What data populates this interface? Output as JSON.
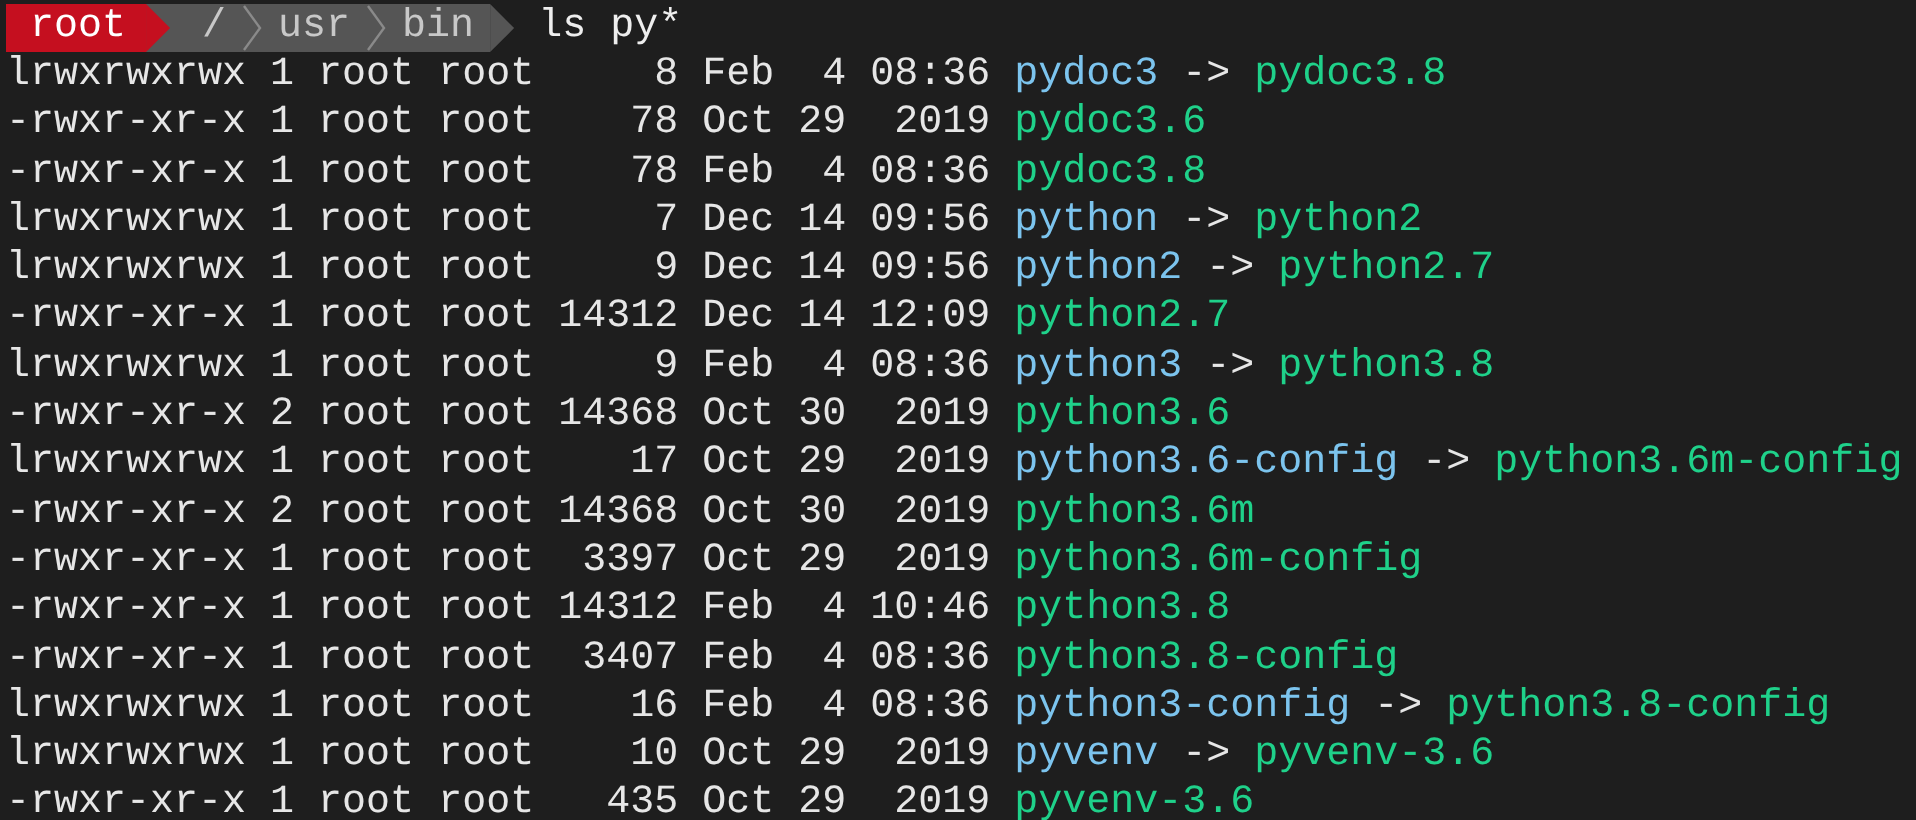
{
  "prompt": {
    "user": "root",
    "path": [
      "/",
      "usr",
      "bin"
    ],
    "command": "ls py*"
  },
  "rows": [
    {
      "mode": "lrwxrwxrwx",
      "links": "1",
      "owner": "root",
      "group": "root",
      "size": "8",
      "date": "Feb  4 08:36",
      "name": "pydoc3",
      "kind": "link",
      "arrow": "->",
      "target": "pydoc3.8"
    },
    {
      "mode": "-rwxr-xr-x",
      "links": "1",
      "owner": "root",
      "group": "root",
      "size": "78",
      "date": "Oct 29  2019",
      "name": "pydoc3.6",
      "kind": "file"
    },
    {
      "mode": "-rwxr-xr-x",
      "links": "1",
      "owner": "root",
      "group": "root",
      "size": "78",
      "date": "Feb  4 08:36",
      "name": "pydoc3.8",
      "kind": "file"
    },
    {
      "mode": "lrwxrwxrwx",
      "links": "1",
      "owner": "root",
      "group": "root",
      "size": "7",
      "date": "Dec 14 09:56",
      "name": "python",
      "kind": "link",
      "arrow": "->",
      "target": "python2"
    },
    {
      "mode": "lrwxrwxrwx",
      "links": "1",
      "owner": "root",
      "group": "root",
      "size": "9",
      "date": "Dec 14 09:56",
      "name": "python2",
      "kind": "link",
      "arrow": "->",
      "target": "python2.7"
    },
    {
      "mode": "-rwxr-xr-x",
      "links": "1",
      "owner": "root",
      "group": "root",
      "size": "14312",
      "date": "Dec 14 12:09",
      "name": "python2.7",
      "kind": "file"
    },
    {
      "mode": "lrwxrwxrwx",
      "links": "1",
      "owner": "root",
      "group": "root",
      "size": "9",
      "date": "Feb  4 08:36",
      "name": "python3",
      "kind": "link",
      "arrow": "->",
      "target": "python3.8"
    },
    {
      "mode": "-rwxr-xr-x",
      "links": "2",
      "owner": "root",
      "group": "root",
      "size": "14368",
      "date": "Oct 30  2019",
      "name": "python3.6",
      "kind": "file"
    },
    {
      "mode": "lrwxrwxrwx",
      "links": "1",
      "owner": "root",
      "group": "root",
      "size": "17",
      "date": "Oct 29  2019",
      "name": "python3.6-config",
      "kind": "link",
      "arrow": "->",
      "target": "python3.6m-config"
    },
    {
      "mode": "-rwxr-xr-x",
      "links": "2",
      "owner": "root",
      "group": "root",
      "size": "14368",
      "date": "Oct 30  2019",
      "name": "python3.6m",
      "kind": "file"
    },
    {
      "mode": "-rwxr-xr-x",
      "links": "1",
      "owner": "root",
      "group": "root",
      "size": "3397",
      "date": "Oct 29  2019",
      "name": "python3.6m-config",
      "kind": "file"
    },
    {
      "mode": "-rwxr-xr-x",
      "links": "1",
      "owner": "root",
      "group": "root",
      "size": "14312",
      "date": "Feb  4 10:46",
      "name": "python3.8",
      "kind": "file"
    },
    {
      "mode": "-rwxr-xr-x",
      "links": "1",
      "owner": "root",
      "group": "root",
      "size": "3407",
      "date": "Feb  4 08:36",
      "name": "python3.8-config",
      "kind": "file"
    },
    {
      "mode": "lrwxrwxrwx",
      "links": "1",
      "owner": "root",
      "group": "root",
      "size": "16",
      "date": "Feb  4 08:36",
      "name": "python3-config",
      "kind": "link",
      "arrow": "->",
      "target": "python3.8-config"
    },
    {
      "mode": "lrwxrwxrwx",
      "links": "1",
      "owner": "root",
      "group": "root",
      "size": "10",
      "date": "Oct 29  2019",
      "name": "pyvenv",
      "kind": "link",
      "arrow": "->",
      "target": "pyvenv-3.6"
    },
    {
      "mode": "-rwxr-xr-x",
      "links": "1",
      "owner": "root",
      "group": "root",
      "size": "435",
      "date": "Oct 29  2019",
      "name": "pyvenv-3.6",
      "kind": "file"
    }
  ]
}
